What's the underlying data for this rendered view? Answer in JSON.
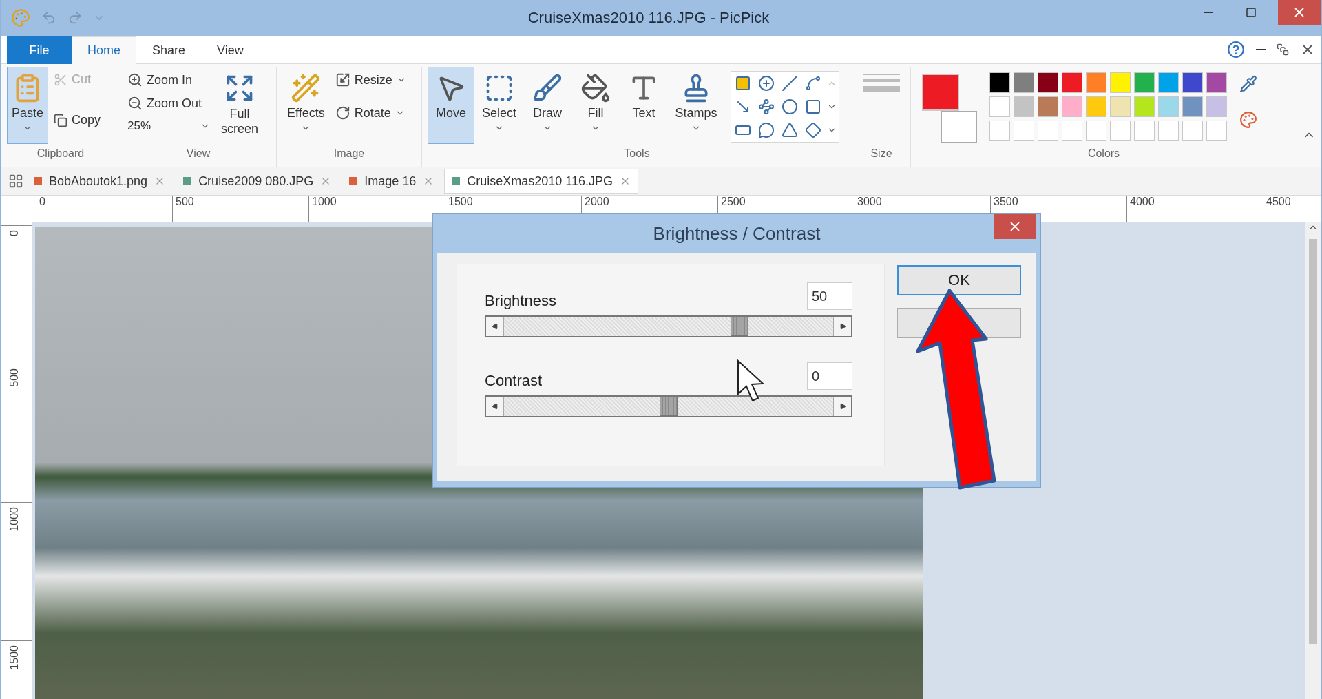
{
  "window": {
    "title": "CruiseXmas2010 116.JPG - PicPick"
  },
  "ribbon_tabs": [
    {
      "label": "File",
      "kind": "file",
      "selected": false
    },
    {
      "label": "Home",
      "kind": "tab",
      "selected": true
    },
    {
      "label": "Share",
      "kind": "tab",
      "selected": false
    },
    {
      "label": "View",
      "kind": "tab",
      "selected": false
    }
  ],
  "clipboard": {
    "label": "Clipboard",
    "paste": "Paste",
    "cut": {
      "label": "Cut",
      "disabled": true
    },
    "copy": {
      "label": "Copy",
      "disabled": false
    }
  },
  "view_group": {
    "label": "View",
    "zoom_in": "Zoom In",
    "zoom_out": "Zoom Out",
    "zoom": "25%",
    "full_screen": "Full screen"
  },
  "image_group": {
    "label": "Image",
    "effects": "Effects",
    "resize": "Resize",
    "rotate": "Rotate"
  },
  "tools_group": {
    "label": "Tools",
    "tools": [
      {
        "label": "Move",
        "kind": "move",
        "selected": true,
        "dropdown": false
      },
      {
        "label": "Select",
        "kind": "select",
        "selected": false,
        "dropdown": true
      },
      {
        "label": "Draw",
        "kind": "draw",
        "selected": false,
        "dropdown": true
      },
      {
        "label": "Fill",
        "kind": "fill",
        "selected": false,
        "dropdown": true
      },
      {
        "label": "Text",
        "kind": "text",
        "selected": false,
        "dropdown": false
      },
      {
        "label": "Stamps",
        "kind": "stamps",
        "selected": false,
        "dropdown": true
      }
    ]
  },
  "size_group": {
    "label": "Size"
  },
  "colors_group": {
    "label": "Colors",
    "current": [
      {
        "color": "#ed1c24"
      },
      {
        "color": "#ffffff"
      }
    ],
    "swatches": [
      {
        "color": "#000000"
      },
      {
        "color": "#7f7f7f"
      },
      {
        "color": "#880015"
      },
      {
        "color": "#ed1c24"
      },
      {
        "color": "#ff7f27"
      },
      {
        "color": "#fff200"
      },
      {
        "color": "#22b14c"
      },
      {
        "color": "#00a2e8"
      },
      {
        "color": "#3f48cc"
      },
      {
        "color": "#a349a4"
      },
      {
        "color": "#ffffff"
      },
      {
        "color": "#c3c3c3"
      },
      {
        "color": "#b97a57"
      },
      {
        "color": "#ffaec9"
      },
      {
        "color": "#ffc90e"
      },
      {
        "color": "#efe4b0"
      },
      {
        "color": "#b5e61d"
      },
      {
        "color": "#99d9ea"
      },
      {
        "color": "#7092be"
      },
      {
        "color": "#c8bfe7"
      },
      {
        "color": "#ffffff"
      },
      {
        "color": "#ffffff"
      },
      {
        "color": "#ffffff"
      },
      {
        "color": "#ffffff"
      },
      {
        "color": "#ffffff"
      },
      {
        "color": "#ffffff"
      },
      {
        "color": "#ffffff"
      },
      {
        "color": "#ffffff"
      },
      {
        "color": "#ffffff"
      },
      {
        "color": "#ffffff"
      }
    ]
  },
  "doc_tabs": [
    {
      "label": "BobAboutok1.png",
      "color": "#d9603b",
      "selected": false
    },
    {
      "label": "Cruise2009 080.JPG",
      "color": "#5a9e86",
      "selected": false
    },
    {
      "label": "Image 16",
      "color": "#d9603b",
      "selected": false
    },
    {
      "label": "CruiseXmas2010 116.JPG",
      "color": "#5a9e86",
      "selected": true
    }
  ],
  "ruler": {
    "x_labels": [
      "0",
      "500",
      "1000",
      "1500",
      "2000",
      "2500",
      "3000",
      "3500",
      "4000",
      "4500"
    ],
    "y_labels": [
      "0",
      "500",
      "1000",
      "1500"
    ]
  },
  "dialog": {
    "title": "Brightness / Contrast",
    "ok": "OK",
    "sliders": [
      {
        "label": "Brightness",
        "value": "50",
        "level": 0.715
      },
      {
        "label": "Contrast",
        "value": "0",
        "level": 0.5
      }
    ]
  }
}
